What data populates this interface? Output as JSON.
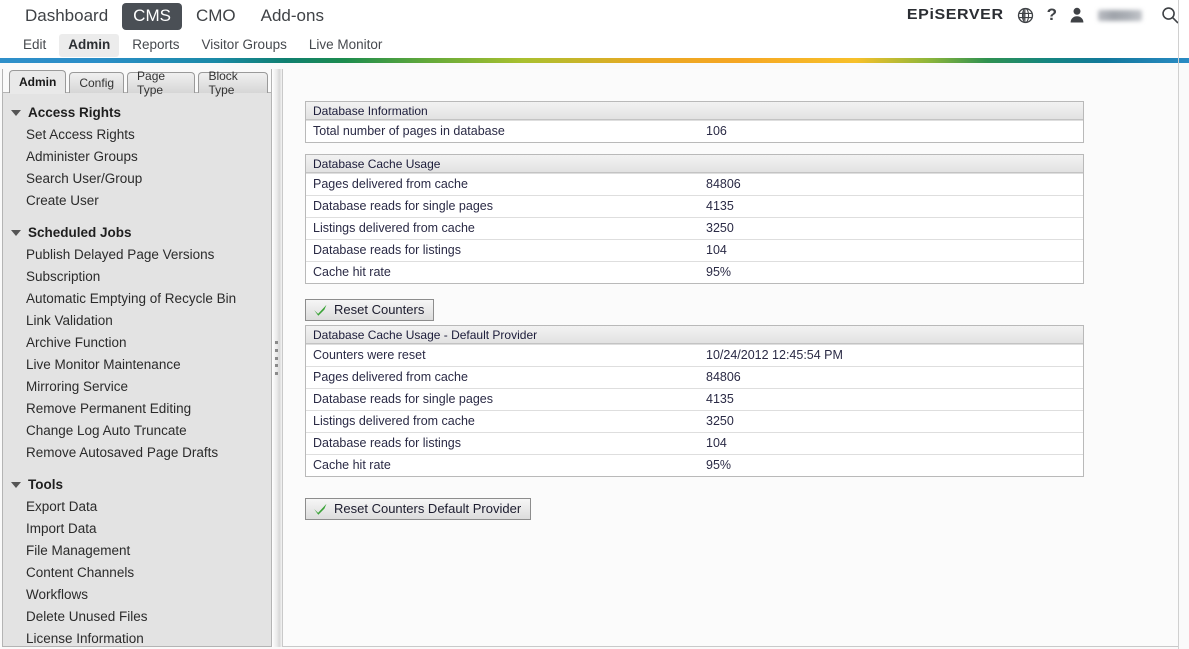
{
  "header": {
    "main_nav": [
      {
        "label": "Dashboard",
        "active": false
      },
      {
        "label": "CMS",
        "active": true
      },
      {
        "label": "CMO",
        "active": false
      },
      {
        "label": "Add-ons",
        "active": false
      }
    ],
    "brand": "EPiSERVER",
    "icons": {
      "globe": "globe-icon",
      "help": "?",
      "user": "user-icon",
      "search": "search-icon"
    },
    "sub_nav": [
      {
        "label": "Edit",
        "active": false
      },
      {
        "label": "Admin",
        "active": true
      },
      {
        "label": "Reports",
        "active": false
      },
      {
        "label": "Visitor Groups",
        "active": false
      },
      {
        "label": "Live Monitor",
        "active": false
      }
    ]
  },
  "sidebar": {
    "tabs": [
      {
        "label": "Admin",
        "active": true
      },
      {
        "label": "Config",
        "active": false
      },
      {
        "label": "Page Type",
        "active": false
      },
      {
        "label": "Block Type",
        "active": false
      }
    ],
    "groups": [
      {
        "title": "Access Rights",
        "items": [
          "Set Access Rights",
          "Administer Groups",
          "Search User/Group",
          "Create User"
        ]
      },
      {
        "title": "Scheduled Jobs",
        "items": [
          "Publish Delayed Page Versions",
          "Subscription",
          "Automatic Emptying of Recycle Bin",
          "Link Validation",
          "Archive Function",
          "Live Monitor Maintenance",
          "Mirroring Service",
          "Remove Permanent Editing",
          "Change Log Auto Truncate",
          "Remove Autosaved Page Drafts"
        ]
      },
      {
        "title": "Tools",
        "items": [
          "Export Data",
          "Import Data",
          "File Management",
          "Content Channels",
          "Workflows",
          "Delete Unused Files",
          "License Information"
        ]
      }
    ]
  },
  "content": {
    "panels": [
      {
        "title": "Database Information",
        "rows": [
          {
            "key": "Total number of pages in database",
            "value": "106"
          }
        ]
      },
      {
        "title": "Database Cache Usage",
        "rows": [
          {
            "key": "Pages delivered from cache",
            "value": "84806"
          },
          {
            "key": "Database reads for single pages",
            "value": "4135"
          },
          {
            "key": "Listings delivered from cache",
            "value": "3250"
          },
          {
            "key": "Database reads for listings",
            "value": "104"
          },
          {
            "key": "Cache hit rate",
            "value": "95%"
          }
        ]
      },
      {
        "title": "Database Cache Usage - Default Provider",
        "rows": [
          {
            "key": "Counters were reset",
            "value": "10/24/2012 12:45:54 PM"
          },
          {
            "key": "Pages delivered from cache",
            "value": "84806"
          },
          {
            "key": "Database reads for single pages",
            "value": "4135"
          },
          {
            "key": "Listings delivered from cache",
            "value": "3250"
          },
          {
            "key": "Database reads for listings",
            "value": "104"
          },
          {
            "key": "Cache hit rate",
            "value": "95%"
          }
        ]
      }
    ],
    "buttons": {
      "reset_counters": "Reset Counters",
      "reset_counters_default": "Reset Counters Default Provider"
    }
  },
  "colors": {
    "accent_active_tab": "#4a4f55",
    "check_green": "#3aa337",
    "panel_border": "#b9b9b9",
    "sidebar_bg": "#e3e3e3"
  }
}
